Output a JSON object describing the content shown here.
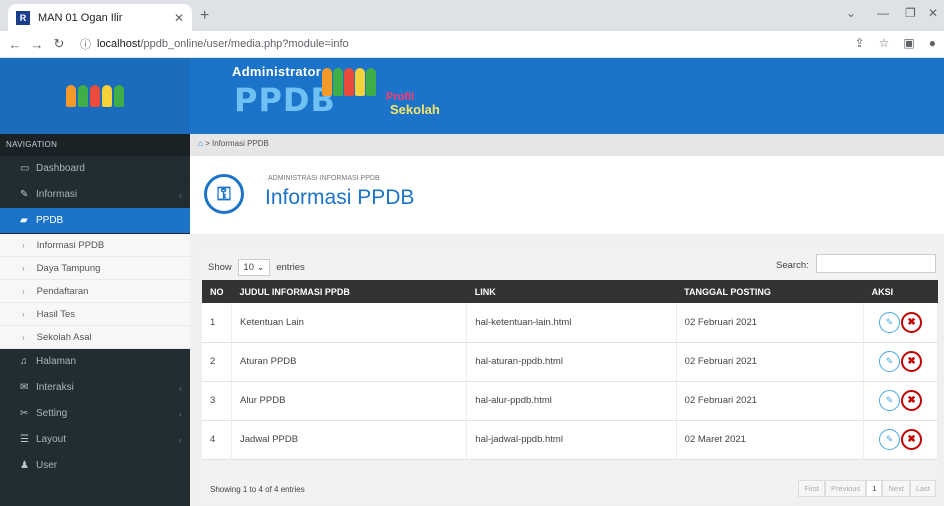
{
  "browser": {
    "tab_title": "MAN 01 Ogan Ilir",
    "favicon_letter": "R",
    "url_host": "localhost",
    "url_path": "/ppdb_online/user/media.php?module=info"
  },
  "banner": {
    "administrator": "Administrator",
    "ppdb": "PPDB",
    "profil": "Profil",
    "sekolah": "Sekolah"
  },
  "sidebar": {
    "header": "NAVIGATION",
    "items": [
      {
        "label": "Dashboard",
        "icon": "monitor-icon"
      },
      {
        "label": "Informasi",
        "icon": "pencil-icon"
      },
      {
        "label": "PPDB",
        "icon": "book-icon"
      },
      {
        "label": "Halaman",
        "icon": "bell-icon"
      },
      {
        "label": "Interaksi",
        "icon": "chat-icon"
      },
      {
        "label": "Setting",
        "icon": "wrench-icon"
      },
      {
        "label": "Layout",
        "icon": "layout-icon"
      },
      {
        "label": "User",
        "icon": "user-icon"
      }
    ],
    "subitems": [
      "Informasi PPDB",
      "Daya Tampung",
      "Pendaftaran",
      "Hasil Tes",
      "Sekolah Asal"
    ]
  },
  "breadcrumb": {
    "current": "Informasi PPDB"
  },
  "page": {
    "subtitle": "ADMINISTRASI INFORMASI PPDB",
    "title": "Informasi PPDB"
  },
  "datatable": {
    "show_label": "Show",
    "entries_value": "10",
    "entries_label": "entries",
    "search_label": "Search:",
    "columns": [
      "NO",
      "JUDUL INFORMASI PPDB",
      "LINK",
      "TANGGAL POSTING",
      "AKSI"
    ],
    "rows": [
      {
        "no": "1",
        "judul": "Ketentuan Lain",
        "link": "hal-ketentuan-lain.html",
        "tanggal": "02 Februari 2021"
      },
      {
        "no": "2",
        "judul": "Aturan PPDB",
        "link": "hal-aturan-ppdb.html",
        "tanggal": "02 Februari 2021"
      },
      {
        "no": "3",
        "judul": "Alur PPDB",
        "link": "hal-alur-ppdb.html",
        "tanggal": "02 Februari 2021"
      },
      {
        "no": "4",
        "judul": "Jadwal PPDB",
        "link": "hal-jadwal-ppdb.html",
        "tanggal": "02 Maret 2021"
      }
    ],
    "info": "Showing 1 to 4 of 4 entries",
    "pager": {
      "first": "First",
      "previous": "Previous",
      "current": "1",
      "next": "Next",
      "last": "Last"
    }
  }
}
